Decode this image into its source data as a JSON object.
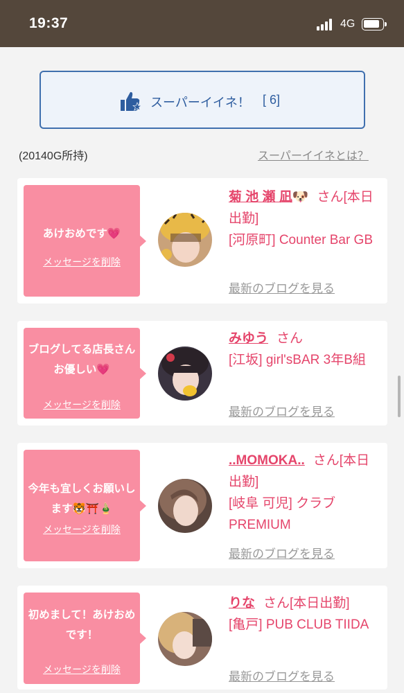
{
  "status": {
    "time": "19:37",
    "network": "4G"
  },
  "super_iine": {
    "label": "スーパーイイネ！",
    "count": "[ 6]"
  },
  "gold": "(20140G所持)",
  "whatis_link": "スーパーイイネとは？",
  "cards": [
    {
      "message": "あけおめです",
      "emoji": "💗",
      "delete": "メッセージを削除",
      "name": "菊 池 瀬 凪",
      "name_emoji": "🐶",
      "san": "さん",
      "shift": "[本日出勤]",
      "shop": "[河原町] Counter Bar GB",
      "blog": "最新のブログを見る"
    },
    {
      "message": "ブログしてる店長さんお優しい",
      "emoji": "💗",
      "delete": "メッセージを削除",
      "name": "みゆう",
      "san": "さん",
      "shop": "[江坂] girl'sBAR 3年B組",
      "blog": "最新のブログを見る"
    },
    {
      "message": "今年も宜しくお願いします",
      "emoji": "🐯⛩️🎍",
      "delete": "メッセージを削除",
      "name": "..MOMOKA..",
      "san": "さん",
      "shift": "[本日出勤]",
      "shop": "[岐阜 可児] クラブPREMIUM",
      "blog": "最新のブログを見る"
    },
    {
      "message": "初めまして！あけおめです！",
      "delete": "メッセージを削除",
      "name": "りな",
      "san": "さん",
      "shift": "[本日出勤]",
      "shop": "[亀戸] PUB CLUB TIIDA",
      "blog": "最新のブログを見る"
    }
  ]
}
